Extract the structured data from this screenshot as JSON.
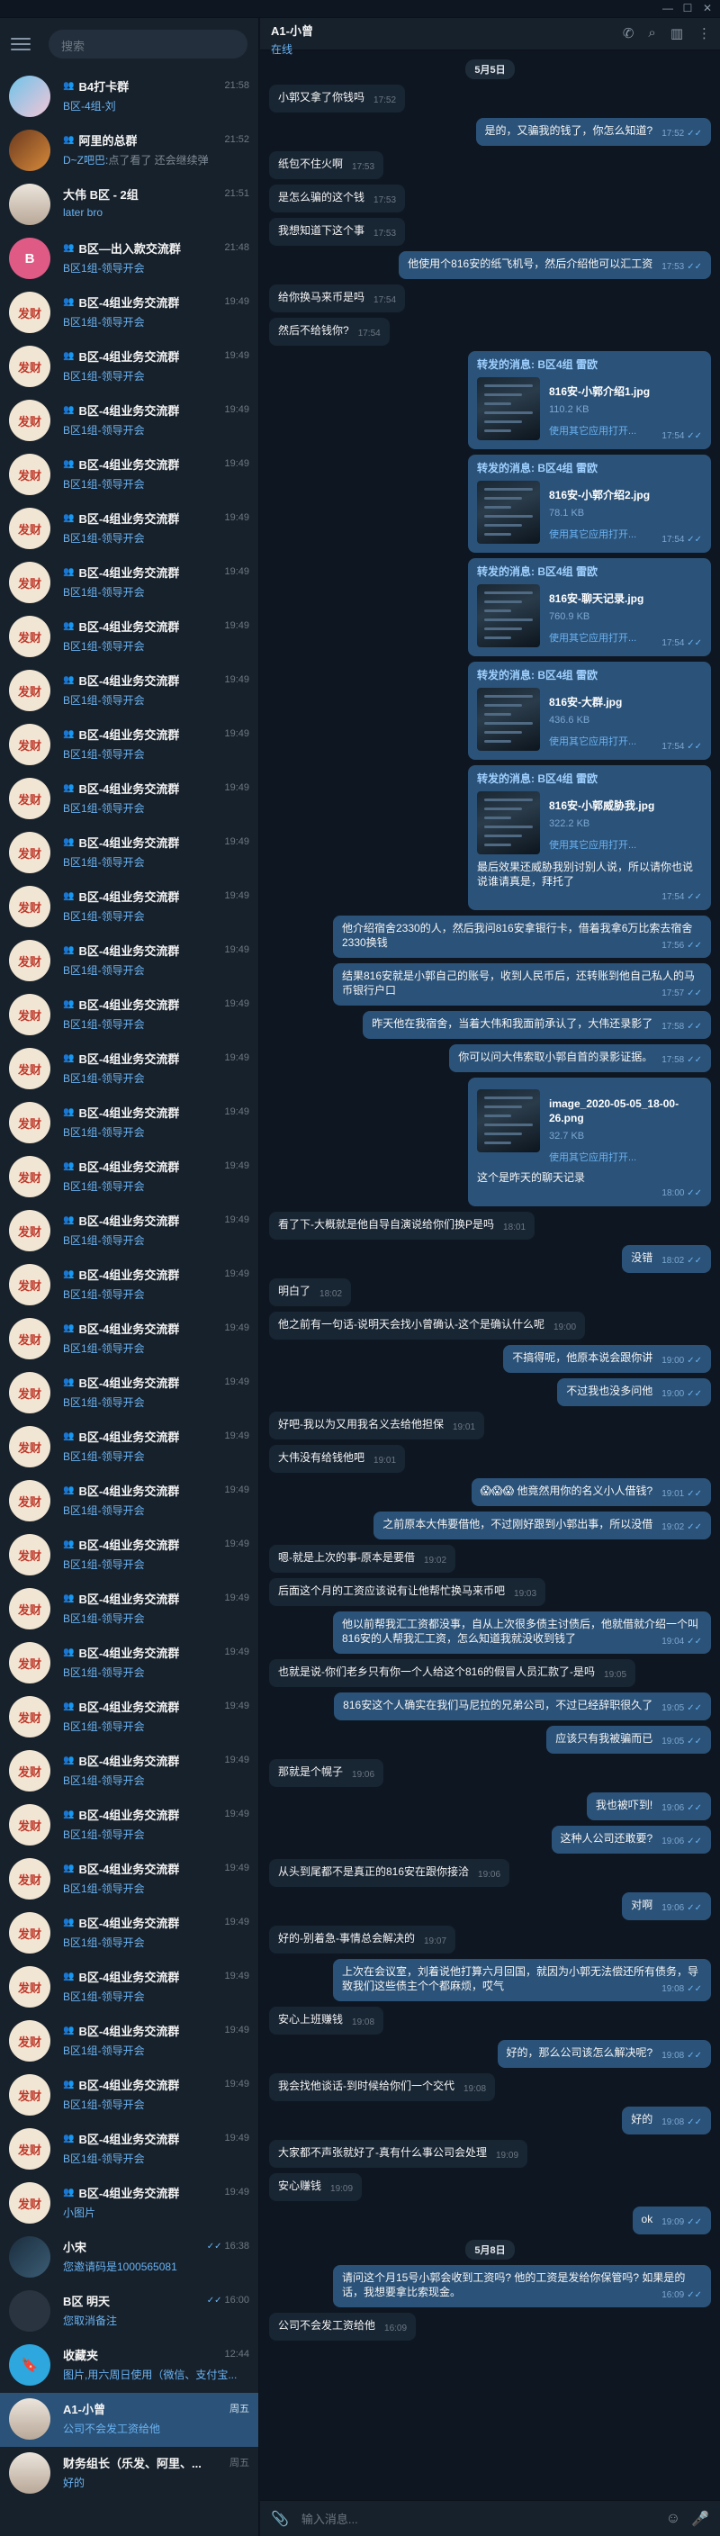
{
  "window": {
    "minimize": "—",
    "maximize": "☐",
    "close": "✕"
  },
  "sidebar": {
    "search_placeholder": "搜索",
    "chats": [
      {
        "name": "B4打卡群",
        "group": true,
        "time": "21:58",
        "sender": "",
        "preview": "B区-4组-刘",
        "avatar": "photo1",
        "avatar_text": ""
      },
      {
        "name": "阿里的总群",
        "group": true,
        "time": "21:52",
        "sender": "D~Z吧巴:",
        "preview": "点了看了  还会继续弹",
        "avatar": "photo2",
        "avatar_text": ""
      },
      {
        "name": "大伟 B区 - 2组",
        "group": false,
        "time": "21:51",
        "sender": "",
        "preview": "later bro",
        "avatar": "photo3",
        "avatar_text": ""
      },
      {
        "name": "B区—出入款交流群",
        "group": true,
        "time": "21:48",
        "sender": "",
        "preview": "B区1组-领导开会",
        "avatar": "pink",
        "avatar_text": "B"
      },
      {
        "name": "B区-4组业务交流群",
        "group": true,
        "time": "19:49",
        "sender": "",
        "preview": "B区1组-领导开会",
        "avatar": "fan",
        "avatar_text": "发财"
      },
      {
        "name": "B区-4组业务交流群",
        "group": true,
        "time": "19:49",
        "sender": "",
        "preview": "B区1组-领导开会",
        "avatar": "fan",
        "avatar_text": "发财"
      },
      {
        "name": "B区-4组业务交流群",
        "group": true,
        "time": "19:49",
        "sender": "",
        "preview": "B区1组-领导开会",
        "avatar": "fan",
        "avatar_text": "发财"
      },
      {
        "name": "B区-4组业务交流群",
        "group": true,
        "time": "19:49",
        "sender": "",
        "preview": "B区1组-领导开会",
        "avatar": "fan",
        "avatar_text": "发财"
      },
      {
        "name": "B区-4组业务交流群",
        "group": true,
        "time": "19:49",
        "sender": "",
        "preview": "B区1组-领导开会",
        "avatar": "fan",
        "avatar_text": "发财"
      },
      {
        "name": "B区-4组业务交流群",
        "group": true,
        "time": "19:49",
        "sender": "",
        "preview": "B区1组-领导开会",
        "avatar": "fan",
        "avatar_text": "发财"
      },
      {
        "name": "B区-4组业务交流群",
        "group": true,
        "time": "19:49",
        "sender": "",
        "preview": "B区1组-领导开会",
        "avatar": "fan",
        "avatar_text": "发财"
      },
      {
        "name": "B区-4组业务交流群",
        "group": true,
        "time": "19:49",
        "sender": "",
        "preview": "B区1组-领导开会",
        "avatar": "fan",
        "avatar_text": "发财"
      },
      {
        "name": "B区-4组业务交流群",
        "group": true,
        "time": "19:49",
        "sender": "",
        "preview": "B区1组-领导开会",
        "avatar": "fan",
        "avatar_text": "发财"
      },
      {
        "name": "B区-4组业务交流群",
        "group": true,
        "time": "19:49",
        "sender": "",
        "preview": "B区1组-领导开会",
        "avatar": "fan",
        "avatar_text": "发财"
      },
      {
        "name": "B区-4组业务交流群",
        "group": true,
        "time": "19:49",
        "sender": "",
        "preview": "B区1组-领导开会",
        "avatar": "fan",
        "avatar_text": "发财"
      },
      {
        "name": "B区-4组业务交流群",
        "group": true,
        "time": "19:49",
        "sender": "",
        "preview": "B区1组-领导开会",
        "avatar": "fan",
        "avatar_text": "发财"
      },
      {
        "name": "B区-4组业务交流群",
        "group": true,
        "time": "19:49",
        "sender": "",
        "preview": "B区1组-领导开会",
        "avatar": "fan",
        "avatar_text": "发财"
      },
      {
        "name": "B区-4组业务交流群",
        "group": true,
        "time": "19:49",
        "sender": "",
        "preview": "B区1组-领导开会",
        "avatar": "fan",
        "avatar_text": "发财"
      },
      {
        "name": "B区-4组业务交流群",
        "group": true,
        "time": "19:49",
        "sender": "",
        "preview": "B区1组-领导开会",
        "avatar": "fan",
        "avatar_text": "发财"
      },
      {
        "name": "B区-4组业务交流群",
        "group": true,
        "time": "19:49",
        "sender": "",
        "preview": "B区1组-领导开会",
        "avatar": "fan",
        "avatar_text": "发财"
      },
      {
        "name": "B区-4组业务交流群",
        "group": true,
        "time": "19:49",
        "sender": "",
        "preview": "B区1组-领导开会",
        "avatar": "fan",
        "avatar_text": "发财"
      },
      {
        "name": "B区-4组业务交流群",
        "group": true,
        "time": "19:49",
        "sender": "",
        "preview": "B区1组-领导开会",
        "avatar": "fan",
        "avatar_text": "发财"
      },
      {
        "name": "B区-4组业务交流群",
        "group": true,
        "time": "19:49",
        "sender": "",
        "preview": "B区1组-领导开会",
        "avatar": "fan",
        "avatar_text": "发财"
      },
      {
        "name": "B区-4组业务交流群",
        "group": true,
        "time": "19:49",
        "sender": "",
        "preview": "B区1组-领导开会",
        "avatar": "fan",
        "avatar_text": "发财"
      },
      {
        "name": "B区-4组业务交流群",
        "group": true,
        "time": "19:49",
        "sender": "",
        "preview": "B区1组-领导开会",
        "avatar": "fan",
        "avatar_text": "发财"
      },
      {
        "name": "B区-4组业务交流群",
        "group": true,
        "time": "19:49",
        "sender": "",
        "preview": "B区1组-领导开会",
        "avatar": "fan",
        "avatar_text": "发财"
      },
      {
        "name": "B区-4组业务交流群",
        "group": true,
        "time": "19:49",
        "sender": "",
        "preview": "B区1组-领导开会",
        "avatar": "fan",
        "avatar_text": "发财"
      },
      {
        "name": "B区-4组业务交流群",
        "group": true,
        "time": "19:49",
        "sender": "",
        "preview": "B区1组-领导开会",
        "avatar": "fan",
        "avatar_text": "发财"
      },
      {
        "name": "B区-4组业务交流群",
        "group": true,
        "time": "19:49",
        "sender": "",
        "preview": "B区1组-领导开会",
        "avatar": "fan",
        "avatar_text": "发财"
      },
      {
        "name": "B区-4组业务交流群",
        "group": true,
        "time": "19:49",
        "sender": "",
        "preview": "B区1组-领导开会",
        "avatar": "fan",
        "avatar_text": "发财"
      },
      {
        "name": "B区-4组业务交流群",
        "group": true,
        "time": "19:49",
        "sender": "",
        "preview": "B区1组-领导开会",
        "avatar": "fan",
        "avatar_text": "发财"
      },
      {
        "name": "B区-4组业务交流群",
        "group": true,
        "time": "19:49",
        "sender": "",
        "preview": "B区1组-领导开会",
        "avatar": "fan",
        "avatar_text": "发财"
      },
      {
        "name": "B区-4组业务交流群",
        "group": true,
        "time": "19:49",
        "sender": "",
        "preview": "B区1组-领导开会",
        "avatar": "fan",
        "avatar_text": "发财"
      },
      {
        "name": "B区-4组业务交流群",
        "group": true,
        "time": "19:49",
        "sender": "",
        "preview": "B区1组-领导开会",
        "avatar": "fan",
        "avatar_text": "发财"
      },
      {
        "name": "B区-4组业务交流群",
        "group": true,
        "time": "19:49",
        "sender": "",
        "preview": "B区1组-领导开会",
        "avatar": "fan",
        "avatar_text": "发财"
      },
      {
        "name": "B区-4组业务交流群",
        "group": true,
        "time": "19:49",
        "sender": "",
        "preview": "B区1组-领导开会",
        "avatar": "fan",
        "avatar_text": "发财"
      },
      {
        "name": "B区-4组业务交流群",
        "group": true,
        "time": "19:49",
        "sender": "",
        "preview": "B区1组-领导开会",
        "avatar": "fan",
        "avatar_text": "发财"
      },
      {
        "name": "B区-4组业务交流群",
        "group": true,
        "time": "19:49",
        "sender": "",
        "preview": "B区1组-领导开会",
        "avatar": "fan",
        "avatar_text": "发财"
      },
      {
        "name": "B区-4组业务交流群",
        "group": true,
        "time": "19:49",
        "sender": "",
        "preview": "B区1组-领导开会",
        "avatar": "fan",
        "avatar_text": "发财"
      },
      {
        "name": "B区-4组业务交流群",
        "group": true,
        "time": "19:49",
        "sender": "",
        "preview": "小图片",
        "avatar": "fan",
        "avatar_text": "发财"
      },
      {
        "name": "小宋",
        "group": false,
        "time": "16:38",
        "sender": "",
        "preview": "您邀请码是1000565081",
        "avatar": "photo4",
        "avatar_text": "",
        "ticks": true
      },
      {
        "name": "B区 明天",
        "group": false,
        "time": "16:00",
        "sender": "",
        "preview": "您取消备注",
        "avatar": "dark",
        "avatar_text": "",
        "ticks": true
      },
      {
        "name": "收藏夹",
        "group": false,
        "time": "12:44",
        "sender": "",
        "preview": "图片,用六周日使用（微信、支付宝...",
        "avatar": "blue",
        "avatar_text": "🔖"
      },
      {
        "name": "A1-小曾",
        "group": false,
        "time": "周五",
        "sender": "",
        "preview": "公司不会发工资给他",
        "avatar": "photo3",
        "avatar_text": "",
        "active": true
      },
      {
        "name": "财务组长（乐发、阿里、...",
        "group": false,
        "time": "周五",
        "sender": "",
        "preview": "好的",
        "avatar": "photo3",
        "avatar_text": ""
      }
    ]
  },
  "chat": {
    "title": "A1-小曾",
    "status": "在线",
    "composer_placeholder": "输入消息...",
    "date1": "5月5日",
    "date2": "5月8日",
    "messages": [
      {
        "dir": "in",
        "text": "小郭又拿了你钱吗",
        "time": "17:52"
      },
      {
        "dir": "out",
        "text": "是的，又骗我的钱了，你怎么知道?",
        "time": "17:52"
      },
      {
        "dir": "in",
        "text": "纸包不住火啊",
        "time": "17:53"
      },
      {
        "dir": "in",
        "text": "是怎么骗的这个钱",
        "time": "17:53"
      },
      {
        "dir": "in",
        "text": "我想知道下这个事",
        "time": "17:53"
      },
      {
        "dir": "out",
        "text": "他使用个816安的纸飞机号，然后介绍他可以汇工资",
        "time": "17:53"
      },
      {
        "dir": "in",
        "text": "给你换马来币是吗",
        "time": "17:54"
      },
      {
        "dir": "in",
        "text": "然后不给钱你?",
        "time": "17:54"
      },
      {
        "dir": "fwd",
        "header": "转发的消息: B区4组 雷欧",
        "file": "816安-小郭介绍1.jpg",
        "size": "110.2 KB",
        "open": "使用其它应用打开...",
        "time": "17:54"
      },
      {
        "dir": "fwd",
        "header": "转发的消息: B区4组 雷欧",
        "file": "816安-小郭介绍2.jpg",
        "size": "78.1 KB",
        "open": "使用其它应用打开...",
        "time": "17:54"
      },
      {
        "dir": "fwd",
        "header": "转发的消息: B区4组 雷欧",
        "file": "816安-聊天记录.jpg",
        "size": "760.9 KB",
        "open": "使用其它应用打开...",
        "time": "17:54"
      },
      {
        "dir": "fwd",
        "header": "转发的消息: B区4组 雷欧",
        "file": "816安-大群.jpg",
        "size": "436.6 KB",
        "open": "使用其它应用打开...",
        "time": "17:54"
      },
      {
        "dir": "fwd",
        "header": "转发的消息: B区4组 雷欧",
        "file": "816安-小郭威胁我.jpg",
        "size": "322.2 KB",
        "open": "使用其它应用打开...",
        "text": "最后效果还威胁我别讨别人说，所以请你也说说谁请真是，拜托了",
        "time": "17:54"
      },
      {
        "dir": "out",
        "text": "他介绍宿舍2330的人，然后我问816安拿银行卡，借着我拿6万比索去宿舍2330换钱",
        "time": "17:56"
      },
      {
        "dir": "out",
        "text": "结果816安就是小郭自己的账号，收到人民币后，还转账到他自己私人的马币银行户口",
        "time": "17:57"
      },
      {
        "dir": "out",
        "text": "昨天他在我宿舍，当着大伟和我面前承认了，大伟还录影了",
        "time": "17:58"
      },
      {
        "dir": "out",
        "text": "你可以问大伟索取小郭自首的录影证据。",
        "time": "17:58"
      },
      {
        "dir": "file",
        "file": "image_2020-05-05_18-00-26.png",
        "size": "32.7 KB",
        "open": "使用其它应用打开...",
        "text": "这个是昨天的聊天记录",
        "time": "18:00"
      },
      {
        "dir": "in",
        "text": "看了下-大概就是他自导自演说给你们换P是吗",
        "time": "18:01"
      },
      {
        "dir": "out",
        "text": "没错",
        "time": "18:02"
      },
      {
        "dir": "in",
        "text": "明白了",
        "time": "18:02"
      },
      {
        "dir": "in",
        "text": "他之前有一句话-说明天会找小曾确认-这个是确认什么呢",
        "time": "19:00"
      },
      {
        "dir": "out",
        "text": "不搞得呢，他原本说会跟你讲",
        "time": "19:00"
      },
      {
        "dir": "out",
        "text": "不过我也没多问他",
        "time": "19:00"
      },
      {
        "dir": "in",
        "text": "好吧-我以为又用我名义去给他担保",
        "time": "19:01"
      },
      {
        "dir": "in",
        "text": "大伟没有给钱他吧",
        "time": "19:01"
      },
      {
        "dir": "out",
        "text": "😱😱😱 他竟然用你的名义小人借钱?",
        "time": "19:01"
      },
      {
        "dir": "out",
        "text": "之前原本大伟要借他，不过刚好跟到小郭出事，所以没借",
        "time": "19:02"
      },
      {
        "dir": "in",
        "text": "嗯-就是上次的事-原本是要借",
        "time": "19:02"
      },
      {
        "dir": "in",
        "text": "后面这个月的工资应该说有让他帮忙换马来币吧",
        "time": "19:03"
      },
      {
        "dir": "out",
        "text": "他以前帮我汇工资都没事，自从上次很多债主讨债后，他就借就介绍一个叫816安的人帮我汇工资，怎么知道我就没收到钱了",
        "time": "19:04"
      },
      {
        "dir": "in",
        "text": "也就是说-你们老乡只有你一个人给这个816的假冒人员汇款了-是吗",
        "time": "19:05"
      },
      {
        "dir": "out",
        "text": "816安这个人确实在我们马尼拉的兄弟公司，不过已经辞职很久了",
        "time": "19:05"
      },
      {
        "dir": "out",
        "text": "应该只有我被骗而已",
        "time": "19:05"
      },
      {
        "dir": "in",
        "text": "那就是个幌子",
        "time": "19:06"
      },
      {
        "dir": "out",
        "text": "我也被吓到!",
        "time": "19:06"
      },
      {
        "dir": "out",
        "text": "这种人公司还敢要?",
        "time": "19:06"
      },
      {
        "dir": "in",
        "text": "从头到尾都不是真正的816安在跟你接洽",
        "time": "19:06"
      },
      {
        "dir": "out",
        "text": "对啊",
        "time": "19:06"
      },
      {
        "dir": "in",
        "text": "好的-别着急-事情总会解决的",
        "time": "19:07"
      },
      {
        "dir": "out",
        "text": "上次在会议室，刘着说他打算六月回国，就因为小郭无法偿还所有债务，导致我们这些债主个个都麻烦，哎气",
        "time": "19:08"
      },
      {
        "dir": "in",
        "text": "安心上班赚钱",
        "time": "19:08"
      },
      {
        "dir": "out",
        "text": "好的，那么公司该怎么解决呢?",
        "time": "19:08"
      },
      {
        "dir": "in",
        "text": "我会找他谈话-到时候给你们一个交代",
        "time": "19:08"
      },
      {
        "dir": "out",
        "text": "好的",
        "time": "19:08"
      },
      {
        "dir": "in",
        "text": "大家都不声张就好了-真有什么事公司会处理",
        "time": "19:09"
      },
      {
        "dir": "in",
        "text": "安心赚钱",
        "time": "19:09"
      },
      {
        "dir": "out",
        "text": "ok",
        "time": "19:09"
      },
      {
        "dir": "date",
        "text": "5月8日"
      },
      {
        "dir": "out",
        "text": "请问这个月15号小郭会收到工资吗? 他的工资是发给你保管吗? 如果是的话，我想要拿比索现金。",
        "time": "16:09"
      },
      {
        "dir": "in",
        "text": "公司不会发工资给他",
        "time": "16:09"
      }
    ]
  }
}
